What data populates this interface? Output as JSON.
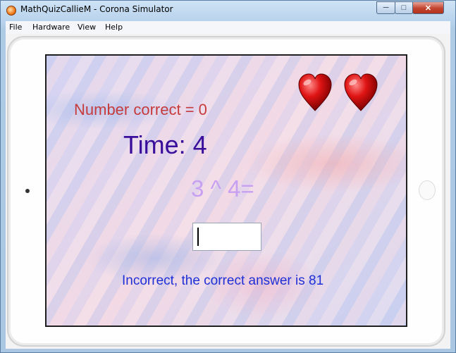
{
  "window": {
    "title": "MathQuizCallieM - Corona Simulator",
    "minimize_glyph": "─",
    "maximize_glyph": "□",
    "close_glyph": "✕"
  },
  "menu": {
    "items": [
      "File",
      "Hardware",
      "View",
      "Help"
    ]
  },
  "game": {
    "number_correct": "Number correct = 0",
    "time": "Time: 4",
    "question": "3 ^ 4=",
    "answer_value": "",
    "feedback": "Incorrect, the correct answer is 81",
    "lives": 2
  },
  "colors": {
    "number_correct": "#c63b3b",
    "time": "#3a0d9a",
    "question": "#c7a0f2",
    "feedback": "#1f2fd6",
    "heart": "#d61010"
  }
}
